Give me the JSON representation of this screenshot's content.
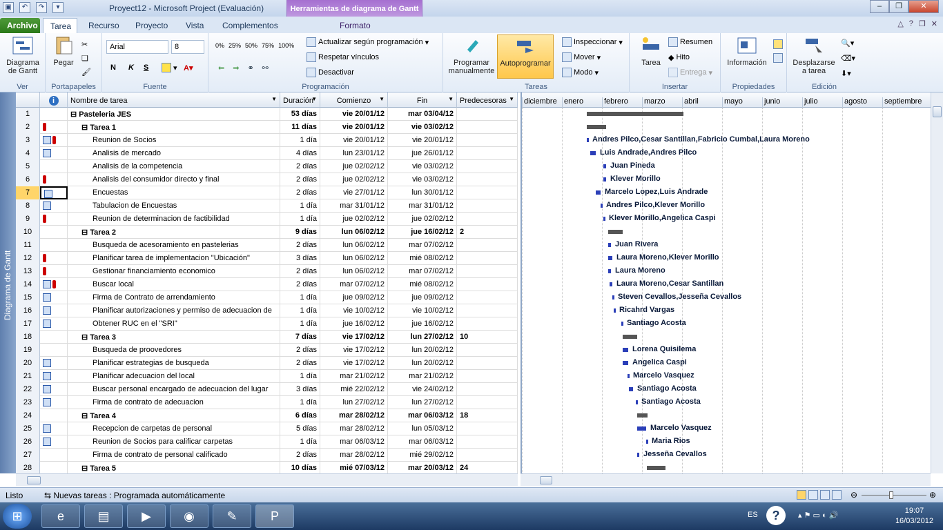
{
  "window": {
    "title": "Proyect12 - Microsoft Project (Evaluación)",
    "context_tab": "Herramientas de diagrama de Gantt",
    "context_sub": "Formato"
  },
  "tabs": [
    "Archivo",
    "Tarea",
    "Recurso",
    "Proyecto",
    "Vista",
    "Complementos"
  ],
  "ribbon": {
    "ver": {
      "btn": "Diagrama\nde Gantt",
      "label": "Ver"
    },
    "portapapeles": {
      "btn": "Pegar",
      "label": "Portapapeles"
    },
    "fuente": {
      "font": "Arial",
      "size": "8",
      "label": "Fuente",
      "bold": "N",
      "italic": "K",
      "underline": "S"
    },
    "programacion": {
      "label": "Programación",
      "actualizar": "Actualizar según programación",
      "respetar": "Respetar vínculos",
      "desactivar": "Desactivar",
      "pcts": [
        "0%",
        "25%",
        "50%",
        "75%",
        "100%"
      ]
    },
    "tareas": {
      "label": "Tareas",
      "programar": "Programar\nmanualmente",
      "auto": "Autoprogramar",
      "inspeccionar": "Inspeccionar",
      "mover": "Mover",
      "modo": "Modo"
    },
    "insertar": {
      "label": "Insertar",
      "tarea": "Tarea",
      "resumen": "Resumen",
      "hito": "Hito",
      "entrega": "Entrega"
    },
    "propiedades": {
      "label": "Propiedades",
      "info": "Información"
    },
    "edicion": {
      "label": "Edición",
      "desplazarse": "Desplazarse\na tarea"
    }
  },
  "columns": {
    "name": "Nombre de tarea",
    "dur": "Duración",
    "start": "Comienzo",
    "end": "Fin",
    "pred": "Predecesoras"
  },
  "rows": [
    {
      "n": "1",
      "name": "Pasteleria JES",
      "dur": "53 días",
      "start": "vie 20/01/12",
      "end": "mar 03/04/12",
      "pred": "",
      "lvl": 0,
      "sum": true,
      "ind": ""
    },
    {
      "n": "2",
      "name": "Tarea 1",
      "dur": "11 días",
      "start": "vie 20/01/12",
      "end": "vie 03/02/12",
      "pred": "",
      "lvl": 1,
      "sum": true,
      "ind": "p"
    },
    {
      "n": "3",
      "name": "Reunion de Socios",
      "dur": "1 día",
      "start": "vie 20/01/12",
      "end": "vie 20/01/12",
      "pred": "",
      "lvl": 2,
      "sum": false,
      "ind": "cp"
    },
    {
      "n": "4",
      "name": "Analisis de mercado",
      "dur": "4 días",
      "start": "lun 23/01/12",
      "end": "jue 26/01/12",
      "pred": "",
      "lvl": 2,
      "sum": false,
      "ind": "c"
    },
    {
      "n": "5",
      "name": "Analisis de la competencia",
      "dur": "2 días",
      "start": "jue 02/02/12",
      "end": "vie 03/02/12",
      "pred": "",
      "lvl": 2,
      "sum": false,
      "ind": ""
    },
    {
      "n": "6",
      "name": "Analisis del consumidor directo y final",
      "dur": "2 días",
      "start": "jue 02/02/12",
      "end": "vie 03/02/12",
      "pred": "",
      "lvl": 2,
      "sum": false,
      "ind": "p"
    },
    {
      "n": "7",
      "name": "Encuestas",
      "dur": "2 días",
      "start": "vie 27/01/12",
      "end": "lun 30/01/12",
      "pred": "",
      "lvl": 2,
      "sum": false,
      "ind": "c",
      "sel": true
    },
    {
      "n": "8",
      "name": "Tabulacion de Encuestas",
      "dur": "1 día",
      "start": "mar 31/01/12",
      "end": "mar 31/01/12",
      "pred": "",
      "lvl": 2,
      "sum": false,
      "ind": "c"
    },
    {
      "n": "9",
      "name": "Reunion de determinacion de factibilidad",
      "dur": "1 día",
      "start": "jue 02/02/12",
      "end": "jue 02/02/12",
      "pred": "",
      "lvl": 2,
      "sum": false,
      "ind": "p"
    },
    {
      "n": "10",
      "name": "Tarea 2",
      "dur": "9 días",
      "start": "lun 06/02/12",
      "end": "jue 16/02/12",
      "pred": "2",
      "lvl": 1,
      "sum": true,
      "ind": ""
    },
    {
      "n": "11",
      "name": "Busqueda de acesoramiento en pastelerias",
      "dur": "2 días",
      "start": "lun 06/02/12",
      "end": "mar 07/02/12",
      "pred": "",
      "lvl": 2,
      "sum": false,
      "ind": ""
    },
    {
      "n": "12",
      "name": "Planificar tarea de implementacion \"Ubicación\"",
      "dur": "3 días",
      "start": "lun 06/02/12",
      "end": "mié 08/02/12",
      "pred": "",
      "lvl": 2,
      "sum": false,
      "ind": "p"
    },
    {
      "n": "13",
      "name": "Gestionar financiamiento economico",
      "dur": "2 días",
      "start": "lun 06/02/12",
      "end": "mar 07/02/12",
      "pred": "",
      "lvl": 2,
      "sum": false,
      "ind": "p"
    },
    {
      "n": "14",
      "name": "Buscar local",
      "dur": "2 días",
      "start": "mar 07/02/12",
      "end": "mié 08/02/12",
      "pred": "",
      "lvl": 2,
      "sum": false,
      "ind": "cp"
    },
    {
      "n": "15",
      "name": "Firma de Contrato de arrendamiento",
      "dur": "1 día",
      "start": "jue 09/02/12",
      "end": "jue 09/02/12",
      "pred": "",
      "lvl": 2,
      "sum": false,
      "ind": "c"
    },
    {
      "n": "16",
      "name": "Planificar autorizaciones y permiso de adecuacion de",
      "dur": "1 día",
      "start": "vie 10/02/12",
      "end": "vie 10/02/12",
      "pred": "",
      "lvl": 2,
      "sum": false,
      "ind": "c"
    },
    {
      "n": "17",
      "name": "Obtener RUC en el \"SRI\"",
      "dur": "1 día",
      "start": "jue 16/02/12",
      "end": "jue 16/02/12",
      "pred": "",
      "lvl": 2,
      "sum": false,
      "ind": "c"
    },
    {
      "n": "18",
      "name": "Tarea 3",
      "dur": "7 días",
      "start": "vie 17/02/12",
      "end": "lun 27/02/12",
      "pred": "10",
      "lvl": 1,
      "sum": true,
      "ind": ""
    },
    {
      "n": "19",
      "name": "Busqueda de proovedores",
      "dur": "2 días",
      "start": "vie 17/02/12",
      "end": "lun 20/02/12",
      "pred": "",
      "lvl": 2,
      "sum": false,
      "ind": ""
    },
    {
      "n": "20",
      "name": "Planificar estrategias de busqueda",
      "dur": "2 días",
      "start": "vie 17/02/12",
      "end": "lun 20/02/12",
      "pred": "",
      "lvl": 2,
      "sum": false,
      "ind": "c"
    },
    {
      "n": "21",
      "name": "Planificar adecuacion del local",
      "dur": "1 día",
      "start": "mar 21/02/12",
      "end": "mar 21/02/12",
      "pred": "",
      "lvl": 2,
      "sum": false,
      "ind": "c"
    },
    {
      "n": "22",
      "name": "Buscar personal encargado de adecuacion del lugar",
      "dur": "3 días",
      "start": "mié 22/02/12",
      "end": "vie 24/02/12",
      "pred": "",
      "lvl": 2,
      "sum": false,
      "ind": "c"
    },
    {
      "n": "23",
      "name": "Firma de contrato de adecuacion",
      "dur": "1 día",
      "start": "lun 27/02/12",
      "end": "lun 27/02/12",
      "pred": "",
      "lvl": 2,
      "sum": false,
      "ind": "c"
    },
    {
      "n": "24",
      "name": "Tarea 4",
      "dur": "6 días",
      "start": "mar 28/02/12",
      "end": "mar 06/03/12",
      "pred": "18",
      "lvl": 1,
      "sum": true,
      "ind": ""
    },
    {
      "n": "25",
      "name": "Recepcion de carpetas de personal",
      "dur": "5 días",
      "start": "mar 28/02/12",
      "end": "lun 05/03/12",
      "pred": "",
      "lvl": 2,
      "sum": false,
      "ind": "c"
    },
    {
      "n": "26",
      "name": "Reunion de Socios para calificar carpetas",
      "dur": "1 día",
      "start": "mar 06/03/12",
      "end": "mar 06/03/12",
      "pred": "",
      "lvl": 2,
      "sum": false,
      "ind": "c"
    },
    {
      "n": "27",
      "name": "Firma de contrato de personal calificado",
      "dur": "2 días",
      "start": "mar 28/02/12",
      "end": "mié 29/02/12",
      "pred": "",
      "lvl": 2,
      "sum": false,
      "ind": ""
    },
    {
      "n": "28",
      "name": "Tarea 5",
      "dur": "10 días",
      "start": "mié 07/03/12",
      "end": "mar 20/03/12",
      "pred": "24",
      "lvl": 1,
      "sum": true,
      "ind": ""
    }
  ],
  "timeline": [
    "diciembre",
    "enero",
    "febrero",
    "marzo",
    "abril",
    "mayo",
    "junio",
    "julio",
    "agosto",
    "septiembre"
  ],
  "gantt_labels": [
    "",
    "",
    "Andres Pilco,Cesar Santillan,Fabricio Cumbal,Laura Moreno",
    "Luis Andrade,Andres Pilco",
    "Juan Pineda",
    "Klever Morillo",
    "Marcelo Lopez,Luis Andrade",
    "Andres Pilco,Klever Morillo",
    "Klever Morillo,Angelica Caspi",
    "",
    "Juan Rivera",
    "Laura Moreno,Klever Morillo",
    "Laura Moreno",
    "Laura Moreno,Cesar Santillan",
    "Steven Cevallos,Jesseña Cevallos",
    "Ricahrd Vargas",
    "Santiago Acosta",
    "",
    "Lorena Quisilema",
    "Angelica Caspi",
    "Marcelo Vasquez",
    "Santiago Acosta",
    "Santiago Acosta",
    "",
    "Marcelo Vasquez",
    "Maria Rios",
    "Jesseña Cevallos",
    ""
  ],
  "status": {
    "ready": "Listo",
    "mode": "Nuevas tareas : Programada automáticamente"
  },
  "vertical_label": "Diagrama de Gantt",
  "tray": {
    "lang": "ES",
    "time": "19:07",
    "date": "16/03/2012"
  }
}
